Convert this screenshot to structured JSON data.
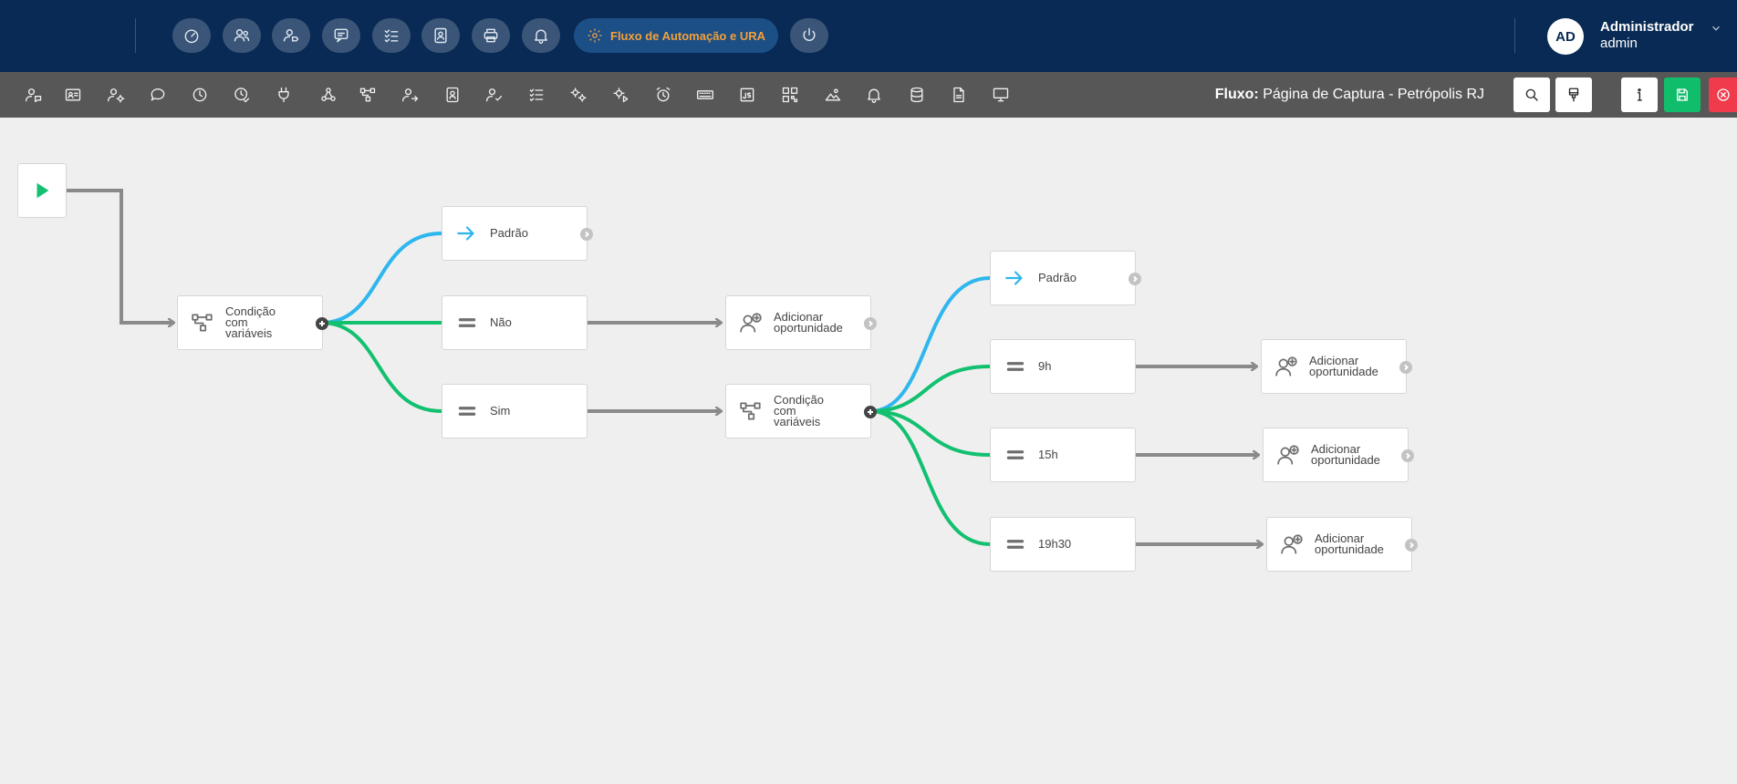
{
  "header": {
    "nav": [
      {
        "name": "dashboard-icon"
      },
      {
        "name": "users-icon"
      },
      {
        "name": "user-tag-icon"
      },
      {
        "name": "chat-icon"
      },
      {
        "name": "checklist-icon"
      },
      {
        "name": "contact-card-icon"
      },
      {
        "name": "printer-icon"
      },
      {
        "name": "bell-icon"
      }
    ],
    "flow_button_label": "Fluxo de Automação e URA",
    "power_icon": "power-icon",
    "user": {
      "initials": "AD",
      "name": "Administrador",
      "role": "admin"
    }
  },
  "toolbar": {
    "title_prefix": "Fluxo:",
    "title": "Página de Captura - Petrópolis RJ"
  },
  "colors": {
    "header_bg": "#082a54",
    "toolbar_bg": "#575757",
    "accent_orange": "#f4a03a",
    "link_blue": "#2eb6ee",
    "link_green": "#12c070",
    "link_gray": "#8a8a8a",
    "save_green": "#0fbd6a",
    "close_red": "#ef3b4b"
  },
  "flow": {
    "nodes": {
      "cond1": {
        "label": "Condição com variáveis"
      },
      "padrao1": {
        "label": "Padrão"
      },
      "nao": {
        "label": "Não"
      },
      "sim": {
        "label": "Sim"
      },
      "add1": {
        "label": "Adicionar oportunidade"
      },
      "cond2": {
        "label": "Condição com variáveis"
      },
      "padrao2": {
        "label": "Padrão"
      },
      "h9": {
        "label": "9h"
      },
      "h15": {
        "label": "15h"
      },
      "h1930": {
        "label": "19h30"
      },
      "add2": {
        "label": "Adicionar oportunidade"
      },
      "add3": {
        "label": "Adicionar oportunidade"
      },
      "add4": {
        "label": "Adicionar oportunidade"
      }
    }
  }
}
